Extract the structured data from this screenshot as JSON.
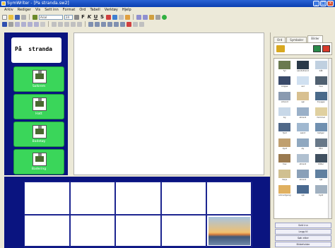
{
  "window": {
    "title": "SymWriter - [Pa stranda.sw2]"
  },
  "menu": [
    "Arkiv",
    "Rediger",
    "Vis",
    "Sett inn",
    "Format",
    "Ord",
    "Tabell",
    "Verktøy",
    "Hjelp"
  ],
  "toolbar": {
    "font_name": "Arial",
    "font_size": "24",
    "format_buttons": [
      "F",
      "K",
      "U",
      "S"
    ]
  },
  "title_cell": "På  stranda",
  "symbols": [
    {
      "label": "Solkrem"
    },
    {
      "label": "Hatt"
    },
    {
      "label": "Badetøy"
    },
    {
      "label": "Badering"
    }
  ],
  "right_panel": {
    "tabs": [
      "Ord",
      "Symboler",
      "Bilder"
    ],
    "active_tab": "Bilder",
    "thumbnails": [
      [
        "fyr",
        "sandstrand",
        "båt"
      ],
      [
        "klippe",
        "sol",
        "hus"
      ],
      [
        "strand",
        "sjø",
        "brygge"
      ],
      [
        "by",
        "strand",
        "himmel"
      ],
      [
        "fjell",
        "sand",
        "bølger"
      ],
      [
        "kyst",
        "øy",
        "tårn"
      ],
      [
        "hav",
        "strand",
        "båter"
      ],
      [
        "ferje",
        "strand",
        "sjø"
      ],
      [
        "solnedgang",
        "sjø",
        "kyst"
      ]
    ],
    "buttons": [
      "Sett inn",
      "Legg til",
      "Søk etter",
      "Bildefolder"
    ]
  },
  "colors": {
    "panel_blue": "#0a1480",
    "symbol_green": "#3ad65a",
    "canvas_white": "#ffffff"
  }
}
